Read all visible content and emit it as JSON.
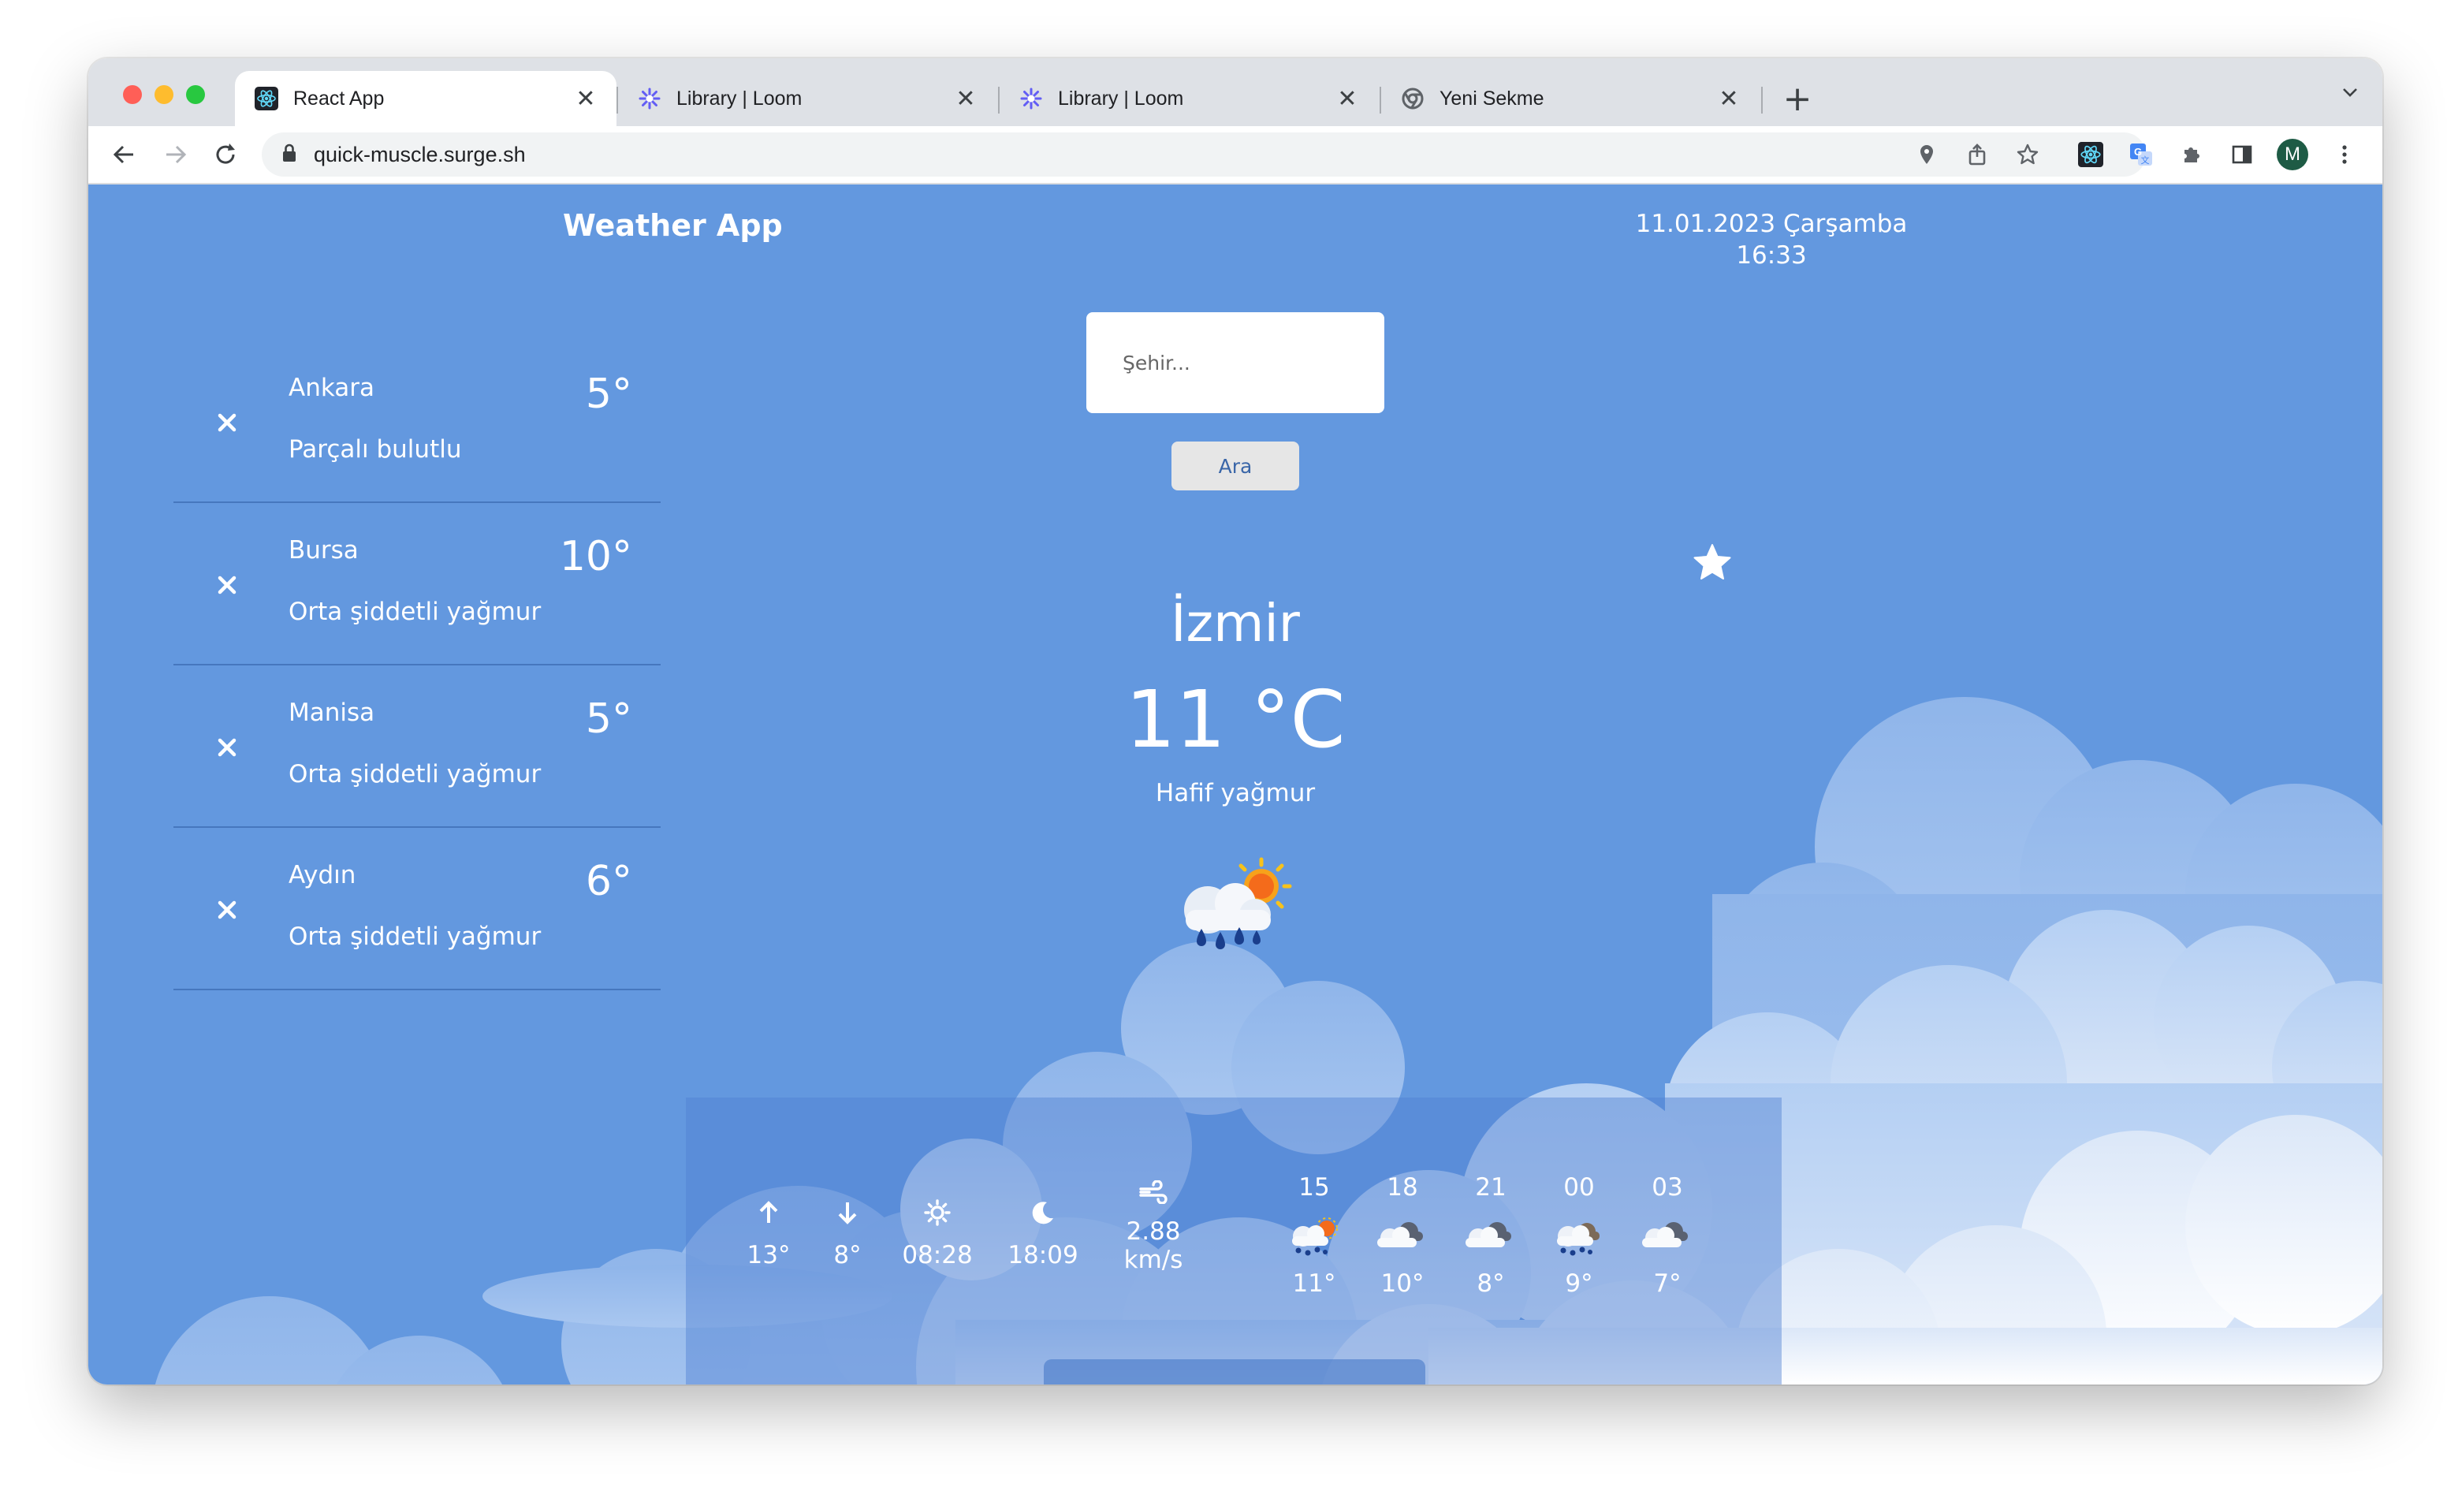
{
  "browser": {
    "tabs": [
      {
        "title": "React App",
        "favicon": "react-icon",
        "active": true
      },
      {
        "title": "Library | Loom",
        "favicon": "loom-icon",
        "active": false
      },
      {
        "title": "Library | Loom",
        "favicon": "loom-icon",
        "active": false
      },
      {
        "title": "Yeni Sekme",
        "favicon": "chrome-icon",
        "active": false
      }
    ],
    "tab_close": "✕",
    "new_tab": "+",
    "url": "quick-muscle.surge.sh",
    "profile_initial": "M"
  },
  "app": {
    "title": "Weather App",
    "date": "11.01.2023 Çarşamba",
    "time": "16:33",
    "search": {
      "placeholder": "Şehir...",
      "button": "Ara"
    }
  },
  "saved_cities": [
    {
      "name": "Ankara",
      "temp": "5°",
      "desc": "Parçalı bulutlu"
    },
    {
      "name": "Bursa",
      "temp": "10°",
      "desc": "Orta şiddetli yağmur"
    },
    {
      "name": "Manisa",
      "temp": "5°",
      "desc": "Orta şiddetli yağmur"
    },
    {
      "name": "Aydın",
      "temp": "6°",
      "desc": "Orta şiddetli yağmur"
    }
  ],
  "current": {
    "city": "İzmir",
    "temp": "11 °C",
    "desc": "Hafif yağmur",
    "icon": "rain-sun-icon"
  },
  "details": {
    "max": "13°",
    "min": "8°",
    "sunrise": "08:28",
    "sunset": "18:09",
    "wind_value": "2.88",
    "wind_unit": "km/s"
  },
  "hourly": [
    {
      "hour": "15",
      "temp": "11°",
      "icon": "rain-sun-icon"
    },
    {
      "hour": "18",
      "temp": "10°",
      "icon": "cloud-icon"
    },
    {
      "hour": "21",
      "temp": "8°",
      "icon": "cloud-icon"
    },
    {
      "hour": "00",
      "temp": "9°",
      "icon": "rain-cloud-icon"
    },
    {
      "hour": "03",
      "temp": "7°",
      "icon": "cloud-icon"
    }
  ],
  "colors": {
    "page_background": "#6398df",
    "tabstrip": "#dee1e6",
    "search_button_text": "#3a66a8"
  }
}
